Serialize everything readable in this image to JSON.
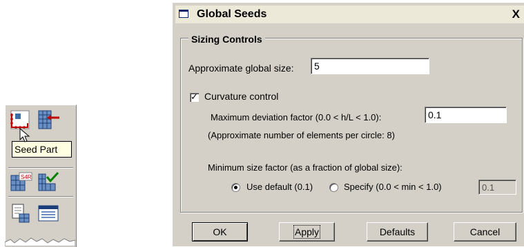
{
  "toolbox": {
    "tooltip": "Seed Part",
    "icons": [
      "seed-part-icon",
      "seed-edge-icon",
      "assign-element-type-icon",
      "verify-mesh-icon",
      "mesh-part-icon",
      "mesh-controls-icon"
    ]
  },
  "dialog": {
    "title": "Global Seeds",
    "close_label": "X",
    "group_label": "Sizing Controls",
    "global_size": {
      "label": "Approximate global size:",
      "value": "5"
    },
    "curvature": {
      "label": "Curvature control",
      "checked": true,
      "deviation_label": "Maximum deviation factor (0.0 < h/L < 1.0):",
      "deviation_value": "0.1",
      "elements_note": "(Approximate number of elements per circle: 8)"
    },
    "min_size": {
      "label": "Minimum size factor (as a fraction of global size):",
      "use_default_label": "Use default (0.1)",
      "use_default_selected": true,
      "specify_label": "Specify (0.0 < min < 1.0)",
      "specify_value": "0.1"
    },
    "buttons": {
      "ok": "OK",
      "apply": "Apply",
      "defaults": "Defaults",
      "cancel": "Cancel"
    }
  },
  "colors": {
    "face": "#d4d0c8",
    "tooltip_bg": "#ffffe1",
    "title_accent": "#0a246a"
  }
}
